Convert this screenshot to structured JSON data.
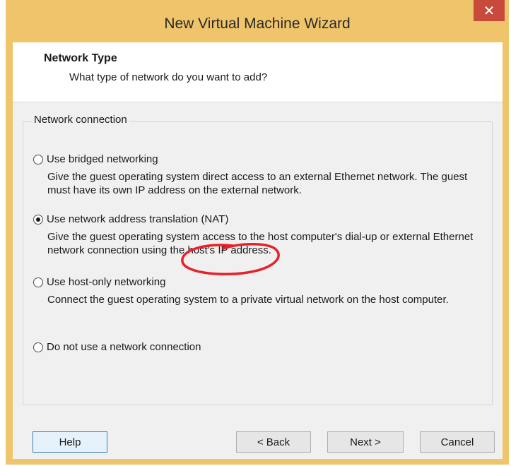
{
  "window": {
    "title": "New Virtual Machine Wizard",
    "close_glyph": "✕"
  },
  "header": {
    "title": "Network Type",
    "subtitle": "What type of network do you want to add?"
  },
  "group": {
    "legend": "Network connection",
    "options": [
      {
        "label": "Use bridged networking",
        "selected": false,
        "description": "Give the guest operating system direct access to an external Ethernet network. The guest must have its own IP address on the external network."
      },
      {
        "label": "Use network address translation (NAT)",
        "selected": true,
        "description": "Give the guest operating system access to the host computer's dial-up or external Ethernet network connection using the host's IP address."
      },
      {
        "label": "Use host-only networking",
        "selected": false,
        "description": "Connect the guest operating system to a private virtual network on the host computer."
      },
      {
        "label": "Do not use a network connection",
        "selected": false,
        "description": ""
      }
    ]
  },
  "buttons": {
    "help": "Help",
    "back": "< Back",
    "next": "Next >",
    "cancel": "Cancel"
  },
  "colors": {
    "title_bar": "#f0c46a",
    "close_button": "#c74a3b",
    "annotation": "#e8202a"
  }
}
